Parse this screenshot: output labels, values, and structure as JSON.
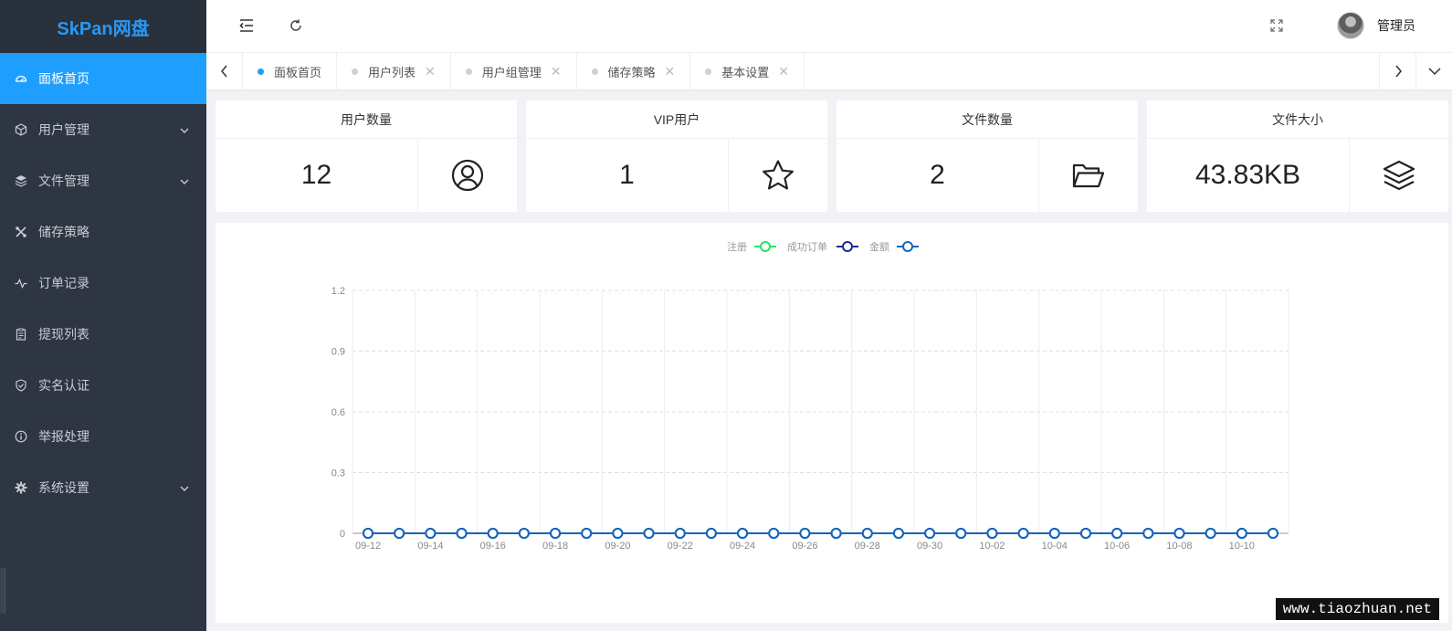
{
  "app": {
    "logo": "SkPan网盘"
  },
  "sidebar": {
    "items": [
      {
        "label": "面板首页",
        "icon": "dashboard-icon",
        "active": true,
        "expandable": false
      },
      {
        "label": "用户管理",
        "icon": "cube-icon",
        "active": false,
        "expandable": true
      },
      {
        "label": "文件管理",
        "icon": "layers-icon",
        "active": false,
        "expandable": true
      },
      {
        "label": "储存策略",
        "icon": "tools-icon",
        "active": false,
        "expandable": false
      },
      {
        "label": "订单记录",
        "icon": "pulse-icon",
        "active": false,
        "expandable": false
      },
      {
        "label": "提现列表",
        "icon": "clipboard-icon",
        "active": false,
        "expandable": false
      },
      {
        "label": "实名认证",
        "icon": "shield-check-icon",
        "active": false,
        "expandable": false
      },
      {
        "label": "举报处理",
        "icon": "info-circle-icon",
        "active": false,
        "expandable": false
      },
      {
        "label": "系统设置",
        "icon": "gear-icon",
        "active": false,
        "expandable": true
      }
    ]
  },
  "header": {
    "username": "管理员"
  },
  "tabs": [
    {
      "label": "面板首页",
      "active": true,
      "closable": false
    },
    {
      "label": "用户列表",
      "active": false,
      "closable": true
    },
    {
      "label": "用户组管理",
      "active": false,
      "closable": true
    },
    {
      "label": "储存策略",
      "active": false,
      "closable": true
    },
    {
      "label": "基本设置",
      "active": false,
      "closable": true
    }
  ],
  "stats": [
    {
      "title": "用户数量",
      "value": "12",
      "icon": "user-circle-icon"
    },
    {
      "title": "VIP用户",
      "value": "1",
      "icon": "star-icon"
    },
    {
      "title": "文件数量",
      "value": "2",
      "icon": "folder-open-icon"
    },
    {
      "title": "文件大小",
      "value": "43.83KB",
      "icon": "layers-icon"
    }
  ],
  "chart_data": {
    "type": "line",
    "title": "",
    "xlabel": "",
    "ylabel": "",
    "ylim": [
      0,
      1.2
    ],
    "yticks": [
      "0",
      "0.3",
      "0.6",
      "0.9",
      "1.2"
    ],
    "grid": true,
    "legend_position": "top-center",
    "x": [
      "09-12",
      "09-13",
      "09-14",
      "09-15",
      "09-16",
      "09-17",
      "09-18",
      "09-19",
      "09-20",
      "09-21",
      "09-22",
      "09-23",
      "09-24",
      "09-25",
      "09-26",
      "09-27",
      "09-28",
      "09-29",
      "09-30",
      "10-01",
      "10-02",
      "10-03",
      "10-04",
      "10-05",
      "10-06",
      "10-07",
      "10-08",
      "10-09",
      "10-10",
      "10-11"
    ],
    "x_tick_labels": [
      "09-12",
      "09-14",
      "09-16",
      "09-18",
      "09-20",
      "09-22",
      "09-24",
      "09-26",
      "09-28",
      "09-30",
      "10-02",
      "10-04",
      "10-06",
      "10-08",
      "10-10"
    ],
    "series": [
      {
        "name": "注册",
        "color": "#22e36a",
        "values": [
          0,
          0,
          0,
          0,
          0,
          0,
          0,
          0,
          0,
          0,
          0,
          0,
          0,
          0,
          0,
          0,
          0,
          0,
          0,
          0,
          0,
          0,
          0,
          0,
          0,
          0,
          0,
          0,
          0,
          0
        ]
      },
      {
        "name": "成功订单",
        "color": "#1b2a8c",
        "values": [
          0,
          0,
          0,
          0,
          0,
          0,
          0,
          0,
          0,
          0,
          0,
          0,
          0,
          0,
          0,
          0,
          0,
          0,
          0,
          0,
          0,
          0,
          0,
          0,
          0,
          0,
          0,
          0,
          0,
          0
        ]
      },
      {
        "name": "金额",
        "color": "#1565c0",
        "values": [
          0,
          0,
          0,
          0,
          0,
          0,
          0,
          0,
          0,
          0,
          0,
          0,
          0,
          0,
          0,
          0,
          0,
          0,
          0,
          0,
          0,
          0,
          0,
          0,
          0,
          0,
          0,
          0,
          0,
          0
        ]
      }
    ]
  },
  "watermark": "www.tiaozhuan.net"
}
